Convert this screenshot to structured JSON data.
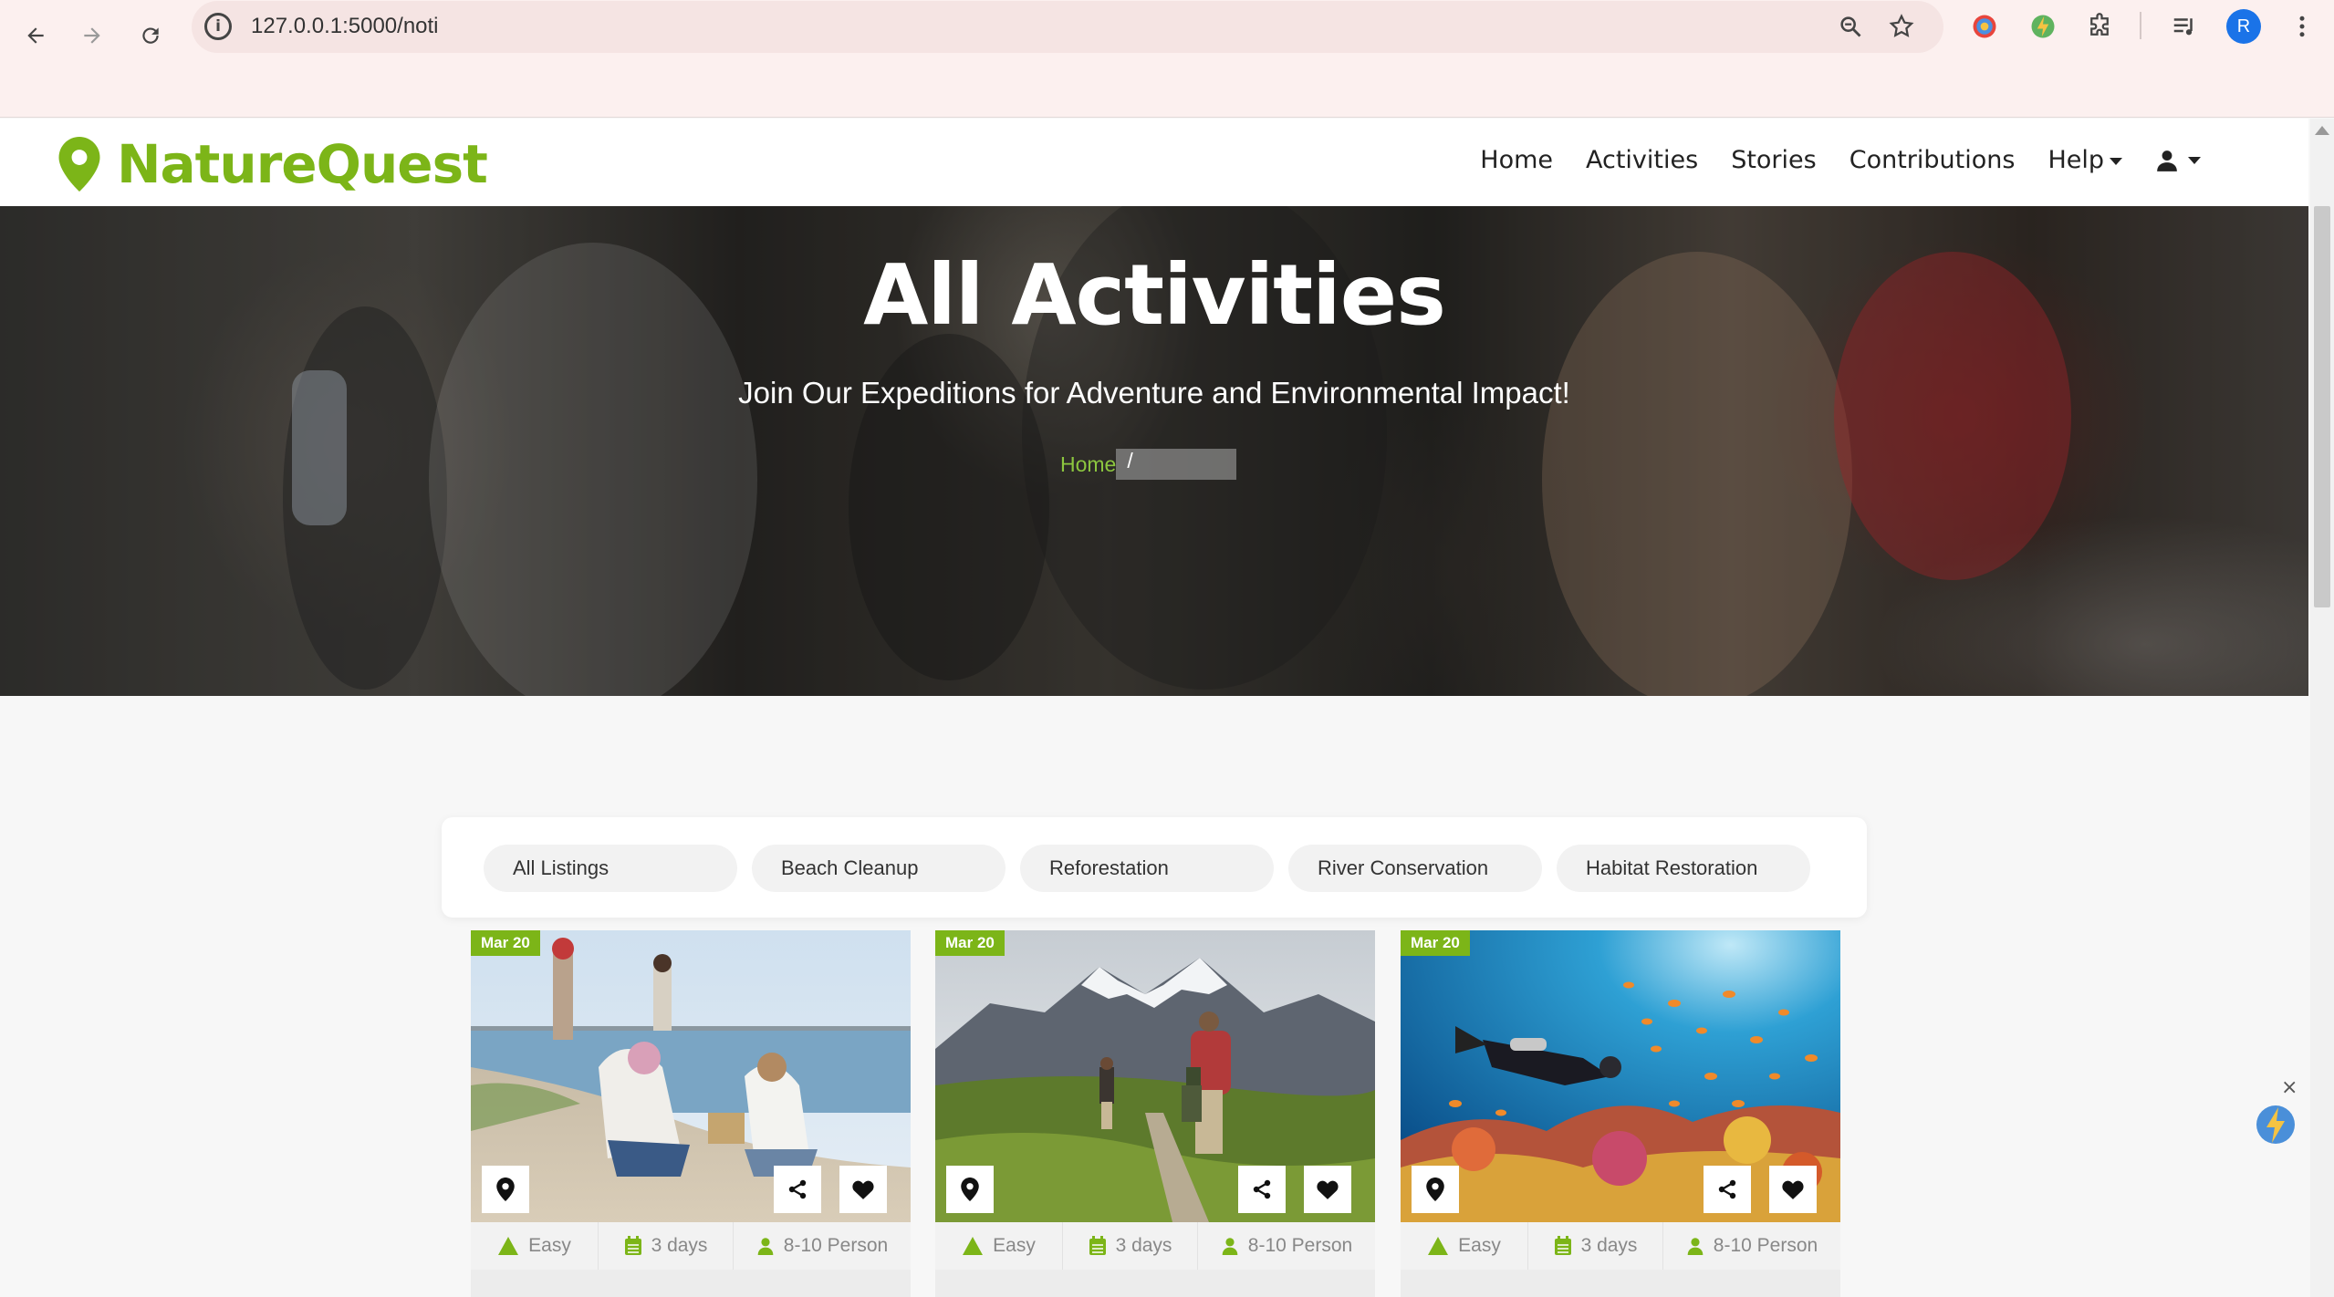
{
  "browser": {
    "url": "127.0.0.1:5000/noti",
    "profile_initial": "R"
  },
  "site": {
    "brand": "NatureQuest",
    "brand_color": "#7cb518",
    "menu": [
      {
        "label": "Home"
      },
      {
        "label": "Activities"
      },
      {
        "label": "Stories"
      },
      {
        "label": "Contributions"
      },
      {
        "label": "Help"
      }
    ]
  },
  "hero": {
    "title": "All Activities",
    "subtitle": "Join Our Expeditions for Adventure and Environmental Impact!",
    "breadcrumb_home": "Home",
    "breadcrumb_sep": "/"
  },
  "filters": [
    "All Listings",
    "Beach Cleanup",
    "Reforestation",
    "River Conservation",
    "Habitat Restoration"
  ],
  "cards": [
    {
      "date": "Mar 20",
      "difficulty": "Easy",
      "duration": "3 days",
      "group": "8-10 Person",
      "image": "beach-cleanup-photo"
    },
    {
      "date": "Mar 20",
      "difficulty": "Easy",
      "duration": "3 days",
      "group": "8-10 Person",
      "image": "mountain-hike-photo"
    },
    {
      "date": "Mar 20",
      "difficulty": "Easy",
      "duration": "3 days",
      "group": "8-10 Person",
      "image": "coral-reef-dive-photo"
    }
  ]
}
